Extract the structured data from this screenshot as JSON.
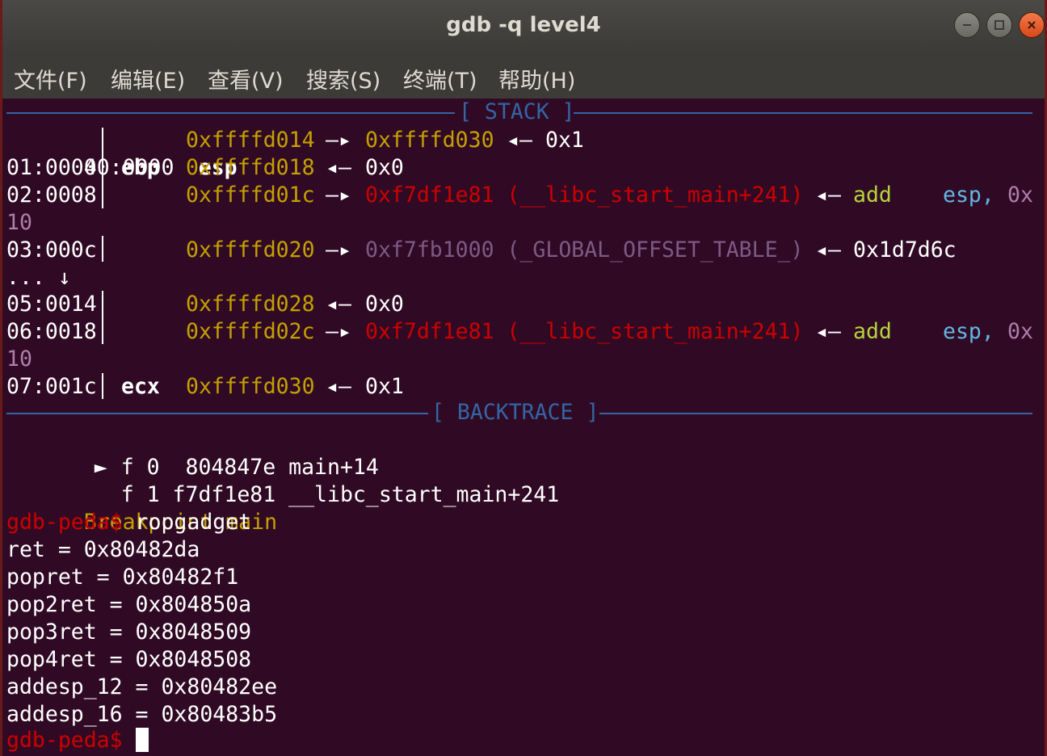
{
  "window": {
    "title": "gdb -q level4"
  },
  "menu": [
    "文件(F)",
    "编辑(E)",
    "查看(V)",
    "搜索(S)",
    "终端(T)",
    "帮助(H)"
  ],
  "stack_header": "[ STACK ]",
  "stack": [
    {
      "idx": "00:0000",
      "reg": "esp",
      "addr": "0xffffd014",
      "arrow1": "—▸",
      "v1": "0xffffd030",
      "arrow2": "◂—",
      "v2": "0x1"
    },
    {
      "idx": "01:0004",
      "reg": "ebp",
      "addr": "0xffffd018",
      "arrow1": "◂—",
      "v1": "0x0"
    },
    {
      "idx": "02:0008",
      "addr": "0xffffd01c",
      "arrow1": "—▸",
      "v1": "0xf7df1e81 (__libc_start_main+241)",
      "arrow2": "◂—",
      "ins": "add",
      "op1": "esp,",
      "op2": "0x"
    },
    {
      "wrap": "10"
    },
    {
      "idx": "03:000c",
      "addr": "0xffffd020",
      "arrow1": "—▸",
      "v1": "0xf7fb1000 (_GLOBAL_OFFSET_TABLE_)",
      "arrow2": "◂—",
      "v2": "0x1d7d6c"
    },
    {
      "ellipsis": "... ↓"
    },
    {
      "idx": "05:0014",
      "addr": "0xffffd028",
      "arrow1": "◂—",
      "v1": "0x0"
    },
    {
      "idx": "06:0018",
      "addr": "0xffffd02c",
      "arrow1": "—▸",
      "v1": "0xf7df1e81 (__libc_start_main+241)",
      "arrow2": "◂—",
      "ins": "add",
      "op1": "esp,",
      "op2": "0x"
    },
    {
      "wrap": "10"
    },
    {
      "idx": "07:001c",
      "reg": "ecx",
      "addr": "0xffffd030",
      "arrow1": "◂—",
      "v1": "0x1"
    }
  ],
  "backtrace_header": "[ BACKTRACE ]",
  "backtrace": [
    {
      "marker": "►",
      "text": "f 0  804847e main+14"
    },
    {
      "marker": "",
      "text": "f 1 f7df1e81 __libc_start_main+241"
    }
  ],
  "breakpoint_msg": "Breakpoint main",
  "prompt": "gdb-peda$",
  "command": " ropgadget",
  "gadgets": [
    "ret = 0x80482da",
    "popret = 0x80482f1",
    "pop2ret = 0x804850a",
    "pop3ret = 0x8048509",
    "pop4ret = 0x8048508",
    "addesp_12 = 0x80482ee",
    "addesp_16 = 0x80483b5"
  ],
  "colors": {
    "background": "#300a24",
    "address_yellow": "#c4a000",
    "code_red": "#cc0000",
    "rodata_gray": "#7c5a85",
    "instr_green": "#b5d33c",
    "operand_cyan": "#62b6e4",
    "number_magenta": "#ad7fa8",
    "header_blue": "#3465a4"
  }
}
